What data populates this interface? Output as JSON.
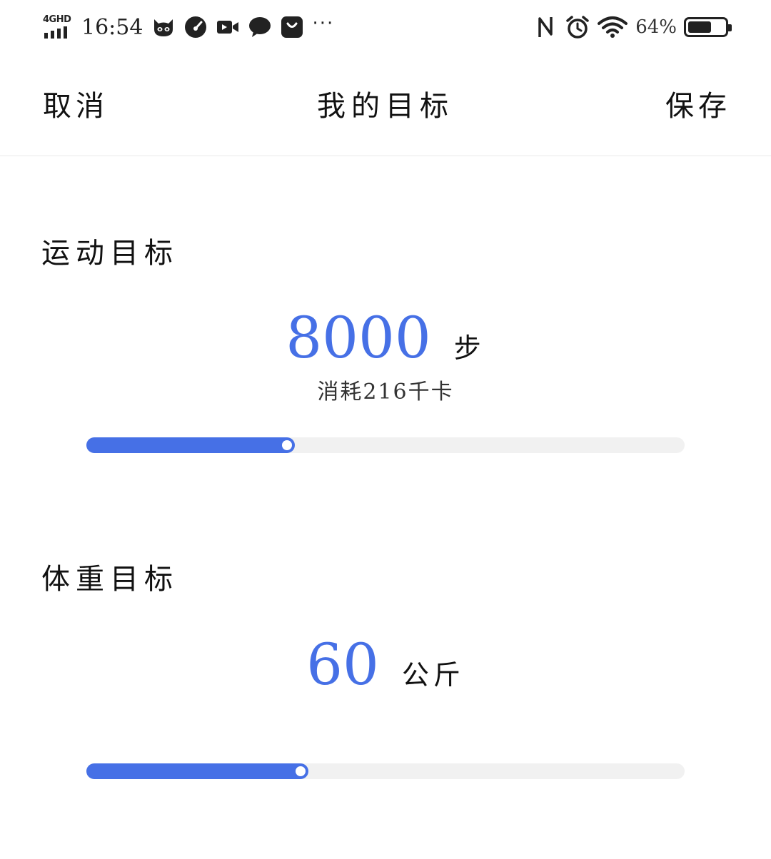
{
  "status_bar": {
    "network": "4GHD",
    "time": "16:54",
    "battery_percent": "64%",
    "battery_level": 0.64,
    "icons": [
      "cat-app-icon",
      "speedometer-icon",
      "video-camera-icon",
      "chat-bubble-icon",
      "shopping-bag-icon",
      "more-dots-icon",
      "nfc-icon",
      "alarm-clock-icon",
      "wifi-icon",
      "battery-icon"
    ],
    "more": "···"
  },
  "nav": {
    "cancel_label": "取消",
    "title": "我的目标",
    "save_label": "保存"
  },
  "exercise_goal": {
    "title": "运动目标",
    "value": "8000",
    "unit": "步",
    "calories_text": "消耗216千卡",
    "slider_fraction": 0.335
  },
  "weight_goal": {
    "title": "体重目标",
    "value": "60",
    "unit": "公斤",
    "slider_fraction": 0.358
  },
  "colors": {
    "accent": "#4670e6",
    "track": "#f1f1f1"
  }
}
